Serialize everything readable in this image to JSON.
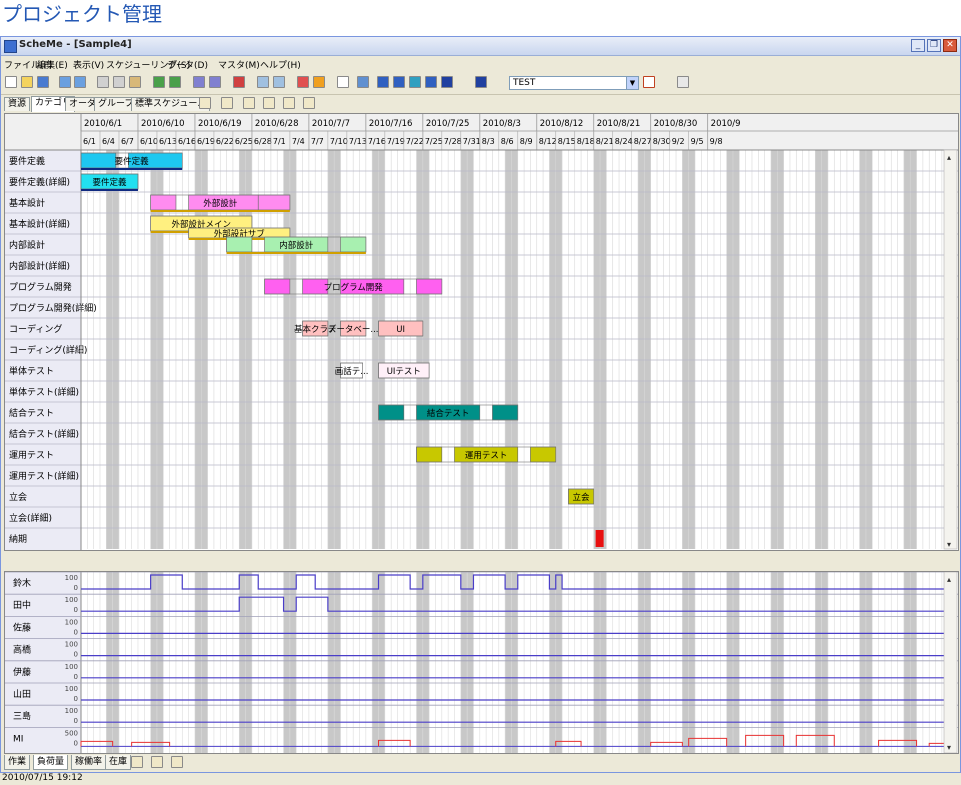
{
  "page_title": "プロジェクト管理",
  "window": {
    "title": "ScheMe - [Sample4]"
  },
  "menu": [
    "ファイル(F)",
    "編集(E)",
    "表示(V)",
    "スケジューリング(S)",
    "データ(D)",
    "マスタ(M)",
    "ヘルプ(H)"
  ],
  "toolbar": {
    "combo_value": "TEST"
  },
  "tabs": [
    {
      "label": "資源",
      "active": false
    },
    {
      "label": "カテゴリ",
      "active": true
    },
    {
      "label": "オーダ",
      "active": false
    },
    {
      "label": "グループ",
      "active": false
    },
    {
      "label": "標準スケジュール",
      "active": false
    }
  ],
  "gantt": {
    "weeks": [
      "2010/6/1",
      "2010/6/10",
      "2010/6/19",
      "2010/6/28",
      "2010/7/7",
      "2010/7/16",
      "2010/7/25",
      "2010/8/3",
      "2010/8/12",
      "2010/8/21",
      "2010/8/30",
      "2010/9"
    ],
    "days": [
      "6/1",
      "6/4",
      "6/7",
      "6/10",
      "6/13",
      "6/16",
      "6/19",
      "6/22",
      "6/25",
      "6/28",
      "7/1",
      "7/4",
      "7/7",
      "7/10",
      "7/13",
      "7/16",
      "7/19",
      "7/22",
      "7/25",
      "7/28",
      "7/31",
      "8/3",
      "8/6",
      "8/9",
      "8/12",
      "8/15",
      "8/18",
      "8/21",
      "8/24",
      "8/27",
      "8/30",
      "9/2",
      "9/5",
      "9/8"
    ],
    "rows": [
      "要件定義",
      "要件定義(詳細)",
      "基本設計",
      "基本設計(詳細)",
      "内部設計",
      "内部設計(詳細)",
      "プログラム開発",
      "プログラム開発(詳細)",
      "コーディング",
      "コーディング(詳細)",
      "単体テスト",
      "単体テスト(詳細)",
      "結合テスト",
      "結合テスト(詳細)",
      "運用テスト",
      "運用テスト(詳細)",
      "立会",
      "立会(詳細)",
      "納期"
    ],
    "bars": [
      {
        "row": 0,
        "start": 0,
        "end": 16,
        "label": "要件定義",
        "fill": "#1ec8f0",
        "segments": [
          [
            0,
            5.5
          ],
          [
            7.5,
            16
          ]
        ],
        "underline": "#102a80"
      },
      {
        "row": 1,
        "start": 0,
        "end": 9,
        "label": "要件定義",
        "fill": "#22e0f0",
        "segments": [
          [
            0,
            9
          ]
        ],
        "underline": "#102a80"
      },
      {
        "row": 2,
        "start": 11,
        "end": 33,
        "label": "外部設計",
        "fill": "#ff8cf0",
        "segments": [
          [
            11,
            15
          ],
          [
            17,
            28
          ],
          [
            28,
            33
          ]
        ],
        "underline": "#d0a000"
      },
      {
        "row": 3,
        "start": 11,
        "end": 27,
        "label": "外部設計メイン",
        "fill": "#fff080",
        "segments": [
          [
            11,
            27
          ]
        ],
        "underline": "#d0a000"
      },
      {
        "row": 3,
        "start": 17,
        "end": 33,
        "label": "外部設計サブ",
        "fill": "#fff080",
        "segments": [
          [
            17,
            33
          ]
        ],
        "underline": "#d0a000",
        "yoff": 12
      },
      {
        "row": 4,
        "start": 23,
        "end": 45,
        "label": "内部設計",
        "fill": "#a8f0b0",
        "segments": [
          [
            23,
            27
          ],
          [
            29,
            39
          ],
          [
            41,
            45
          ]
        ],
        "underline": "#d0a000"
      },
      {
        "row": 6,
        "start": 29,
        "end": 57,
        "label": "プログラム開発",
        "fill": "#ff60f0",
        "segments": [
          [
            29,
            33
          ],
          [
            35,
            39
          ],
          [
            41,
            51
          ],
          [
            53,
            57
          ]
        ]
      },
      {
        "row": 8,
        "start": 35,
        "end": 39,
        "label": "基本クラス",
        "fill": "#ffc0c0",
        "segments": [
          [
            35,
            39
          ]
        ]
      },
      {
        "row": 8,
        "start": 41,
        "end": 45,
        "label": "データベー...",
        "fill": "#ffc0c0",
        "segments": [
          [
            41,
            45
          ]
        ]
      },
      {
        "row": 8,
        "start": 47,
        "end": 54,
        "label": "UI",
        "fill": "#ffc0c0",
        "segments": [
          [
            47,
            54
          ]
        ]
      },
      {
        "row": 10,
        "start": 41,
        "end": 44.5,
        "label": "画話テ...",
        "fill": "#ffffff",
        "segments": [
          [
            41,
            44.5
          ]
        ]
      },
      {
        "row": 10,
        "start": 47,
        "end": 55,
        "label": "UIテスト",
        "fill": "#fff0f8",
        "segments": [
          [
            47,
            55
          ]
        ]
      },
      {
        "row": 12,
        "start": 47,
        "end": 69,
        "label": "結合テスト",
        "fill": "#009088",
        "segments": [
          [
            47,
            51
          ],
          [
            53,
            63
          ],
          [
            65,
            69
          ]
        ]
      },
      {
        "row": 14,
        "start": 53,
        "end": 75,
        "label": "運用テスト",
        "fill": "#c8c800",
        "segments": [
          [
            53,
            57
          ],
          [
            59,
            69
          ],
          [
            71,
            75
          ]
        ]
      },
      {
        "row": 16,
        "start": 77,
        "end": 81,
        "label": "立会",
        "fill": "#c8c800",
        "segments": [
          [
            77,
            81
          ]
        ]
      }
    ],
    "deadline": {
      "row": 18,
      "day": 81.3,
      "color": "#e81010"
    }
  },
  "resources": {
    "rows": [
      {
        "name": "鈴木",
        "max": "100",
        "zero": "0"
      },
      {
        "name": "田中",
        "max": "100",
        "zero": "0"
      },
      {
        "name": "佐藤",
        "max": "100",
        "zero": "0"
      },
      {
        "name": "高橋",
        "max": "100",
        "zero": "0"
      },
      {
        "name": "伊藤",
        "max": "100",
        "zero": "0"
      },
      {
        "name": "山田",
        "max": "100",
        "zero": "0"
      },
      {
        "name": "三島",
        "max": "100",
        "zero": "0"
      },
      {
        "name": "MI",
        "max": "500",
        "zero": "0"
      }
    ]
  },
  "bottom_tabs": [
    {
      "label": "作業",
      "active": false
    },
    {
      "label": "負荷量",
      "active": true
    },
    {
      "label": "稼働率",
      "active": false
    },
    {
      "label": "在庫",
      "active": false
    }
  ],
  "status": {
    "datetime": "2010/07/15 19:12"
  },
  "colors": {
    "grid": "#c8c8c8",
    "weekend": "#c8c8c8",
    "row_header_bg": "#ebebf5",
    "load_line": "#4a3ec8",
    "mi_line": "#e83030"
  }
}
